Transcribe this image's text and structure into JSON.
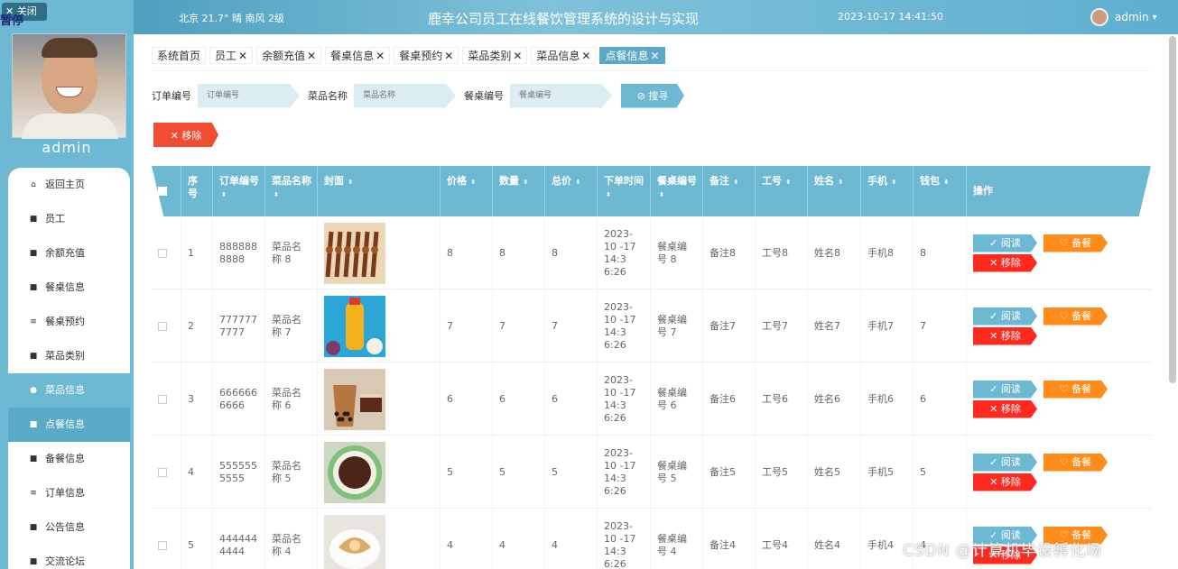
{
  "sidebar": {
    "close_label": "关闭",
    "pause_label": "暂停",
    "username": "admin",
    "items": [
      {
        "label": "返回主页",
        "icon": "⌂"
      },
      {
        "label": "员工",
        "icon": "■"
      },
      {
        "label": "余额充值",
        "icon": "■"
      },
      {
        "label": "餐桌信息",
        "icon": "■"
      },
      {
        "label": "餐桌预约",
        "icon": "≡"
      },
      {
        "label": "菜品类别",
        "icon": "■"
      },
      {
        "label": "菜品信息",
        "icon": "●"
      },
      {
        "label": "点餐信息",
        "icon": "■"
      },
      {
        "label": "备餐信息",
        "icon": "■"
      },
      {
        "label": "订单信息",
        "icon": "≡"
      },
      {
        "label": "公告信息",
        "icon": "■"
      },
      {
        "label": "交流论坛",
        "icon": "■"
      }
    ]
  },
  "header": {
    "weather": "北京  21.7°  晴  南风  2级",
    "title": "鹿幸公司员工在线餐饮管理系统的设计与实现",
    "datetime": "2023-10-17 14:41:50",
    "user": "admin"
  },
  "tabs": [
    "系统首页",
    "员工",
    "余额充值",
    "餐桌信息",
    "餐桌预约",
    "菜品类别",
    "菜品信息",
    "点餐信息"
  ],
  "filters": {
    "order_label": "订单编号",
    "order_placeholder": "订单编号",
    "dish_label": "菜品名称",
    "dish_placeholder": "菜品名称",
    "table_label": "餐桌编号",
    "table_placeholder": "餐桌编号",
    "search_label": "搜寻"
  },
  "remove_label": "移除",
  "columns": [
    "序号",
    "订单编号",
    "菜品名称",
    "封面",
    "价格",
    "数量",
    "总价",
    "下单时间",
    "餐桌编号",
    "备注",
    "工号",
    "姓名",
    "手机",
    "钱包",
    "操作"
  ],
  "actions": {
    "read": "阅读",
    "prep": "备餐",
    "del": "移除"
  },
  "rows": [
    {
      "idx": "1",
      "order": "888888 8888",
      "dish": "菜品名称 8",
      "price": "8",
      "qty": "8",
      "total": "8",
      "time": "2023-10 -17 14:3 6:26",
      "table": "餐桌编号 8",
      "note": "备注8",
      "emp": "工号8",
      "name": "姓名8",
      "phone": "手机8",
      "wallet": "8"
    },
    {
      "idx": "2",
      "order": "777777 7777",
      "dish": "菜品名称 7",
      "price": "7",
      "qty": "7",
      "total": "7",
      "time": "2023-10 -17 14:3 6:26",
      "table": "餐桌编号 7",
      "note": "备注7",
      "emp": "工号7",
      "name": "姓名7",
      "phone": "手机7",
      "wallet": "7"
    },
    {
      "idx": "3",
      "order": "666666 6666",
      "dish": "菜品名称 6",
      "price": "6",
      "qty": "6",
      "total": "6",
      "time": "2023-10 -17 14:3 6:26",
      "table": "餐桌编号 6",
      "note": "备注6",
      "emp": "工号6",
      "name": "姓名6",
      "phone": "手机6",
      "wallet": "6"
    },
    {
      "idx": "4",
      "order": "555555 5555",
      "dish": "菜品名称 5",
      "price": "5",
      "qty": "5",
      "total": "5",
      "time": "2023-10 -17 14:3 6:26",
      "table": "餐桌编号 5",
      "note": "备注5",
      "emp": "工号5",
      "name": "姓名5",
      "phone": "手机5",
      "wallet": "5"
    },
    {
      "idx": "5",
      "order": "444444 4444",
      "dish": "菜品名称 4",
      "price": "4",
      "qty": "4",
      "total": "4",
      "time": "2023-10 -17 14:3 6:26",
      "table": "餐桌编号 4",
      "note": "备注4",
      "emp": "工号4",
      "name": "姓名4",
      "phone": "手机4",
      "wallet": "4"
    }
  ],
  "watermark": "CSDN @计算机毕设孵化场",
  "colors": {
    "accent": "#6db8d3",
    "danger": "#f14d32",
    "warn": "#ff8c1a"
  }
}
